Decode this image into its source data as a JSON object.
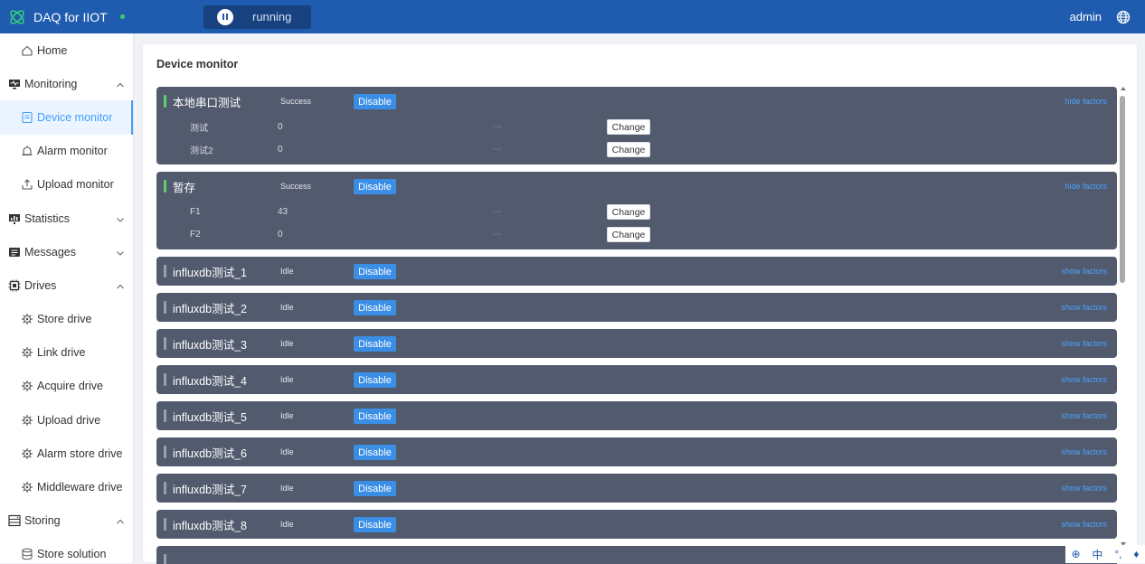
{
  "app": {
    "title": "DAQ for IIOT",
    "run_status": "running",
    "user": "admin"
  },
  "sidebar": {
    "items": [
      {
        "label": "Home",
        "icon": "home-icon",
        "level": "top",
        "style": "home"
      },
      {
        "label": "Monitoring",
        "icon": "monitor-icon",
        "level": "top",
        "chevron": "up"
      },
      {
        "label": "Device monitor",
        "icon": "device-icon",
        "level": "sub",
        "active": true
      },
      {
        "label": "Alarm monitor",
        "icon": "alarm-icon",
        "level": "sub"
      },
      {
        "label": "Upload monitor",
        "icon": "upload-icon",
        "level": "sub"
      },
      {
        "label": "Statistics",
        "icon": "chart-icon",
        "level": "top",
        "chevron": "down"
      },
      {
        "label": "Messages",
        "icon": "message-icon",
        "level": "top",
        "chevron": "down"
      },
      {
        "label": "Drives",
        "icon": "cpu-icon",
        "level": "top",
        "chevron": "up"
      },
      {
        "label": "Store drive",
        "icon": "gear-icon",
        "level": "sub"
      },
      {
        "label": "Link drive",
        "icon": "gear-icon",
        "level": "sub"
      },
      {
        "label": "Acquire drive",
        "icon": "gear-icon",
        "level": "sub"
      },
      {
        "label": "Upload drive",
        "icon": "gear-icon",
        "level": "sub"
      },
      {
        "label": "Alarm store drive",
        "icon": "gear-icon",
        "level": "sub"
      },
      {
        "label": "Middleware drive",
        "icon": "gear-icon",
        "level": "sub"
      },
      {
        "label": "Storing",
        "icon": "storage-icon",
        "level": "top",
        "chevron": "up"
      },
      {
        "label": "Store solution",
        "icon": "database-icon",
        "level": "sub"
      }
    ]
  },
  "main": {
    "title": "Device monitor",
    "disable_label": "Disable",
    "change_label": "Change",
    "devices": [
      {
        "name": "本地串口测试",
        "status": "Success",
        "state": "ok",
        "toggle": "hide factors",
        "factors": [
          {
            "name": "测试",
            "value": "0",
            "dash": "---"
          },
          {
            "name": "测试2",
            "value": "0",
            "dash": "---"
          }
        ]
      },
      {
        "name": "暂存",
        "status": "Success",
        "state": "ok",
        "toggle": "hide factors",
        "factors": [
          {
            "name": "F1",
            "value": "43",
            "dash": "---"
          },
          {
            "name": "F2",
            "value": "0",
            "dash": "---"
          }
        ]
      },
      {
        "name": "influxdb测试_1",
        "status": "Idle",
        "state": "idle",
        "toggle": "show factors"
      },
      {
        "name": "influxdb测试_2",
        "status": "Idle",
        "state": "idle",
        "toggle": "show factors"
      },
      {
        "name": "influxdb测试_3",
        "status": "Idle",
        "state": "idle",
        "toggle": "show factors"
      },
      {
        "name": "influxdb测试_4",
        "status": "Idle",
        "state": "idle",
        "toggle": "show factors"
      },
      {
        "name": "influxdb测试_5",
        "status": "Idle",
        "state": "idle",
        "toggle": "show factors"
      },
      {
        "name": "influxdb测试_6",
        "status": "Idle",
        "state": "idle",
        "toggle": "show factors"
      },
      {
        "name": "influxdb测试_7",
        "status": "Idle",
        "state": "idle",
        "toggle": "show factors"
      },
      {
        "name": "influxdb测试_8",
        "status": "Idle",
        "state": "idle",
        "toggle": "show factors"
      },
      {
        "name": "",
        "status": "",
        "state": "idle",
        "toggle": ""
      }
    ]
  },
  "ime": {
    "lang": "中",
    "punct": "°,",
    "mic": "mic-icon"
  }
}
